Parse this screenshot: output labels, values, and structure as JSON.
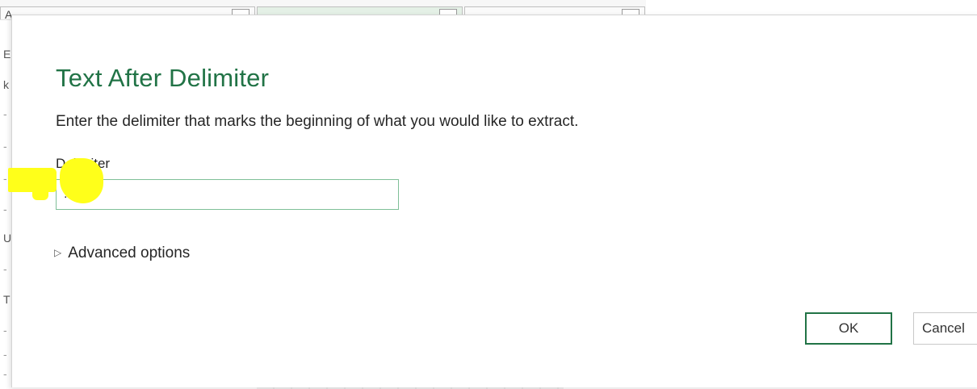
{
  "background": {
    "column_header_letter": "A",
    "gutter_items": [
      "E",
      "k",
      "-",
      "-",
      "-",
      "-",
      "U",
      "-",
      "T",
      "-",
      "-",
      "-"
    ]
  },
  "dialog": {
    "title": "Text After Delimiter",
    "description": "Enter the delimiter that marks the beginning of what you would like to extract.",
    "delimiter_label": "Delimiter",
    "delimiter_value": ":",
    "advanced_options_label": "Advanced options",
    "advanced_icon": "expand-triangle-icon",
    "ok_label": "OK",
    "cancel_label": "Cancel"
  },
  "colors": {
    "title_accent": "#217346",
    "input_border": "#7fbf98",
    "highlight": "#ffff1a"
  }
}
